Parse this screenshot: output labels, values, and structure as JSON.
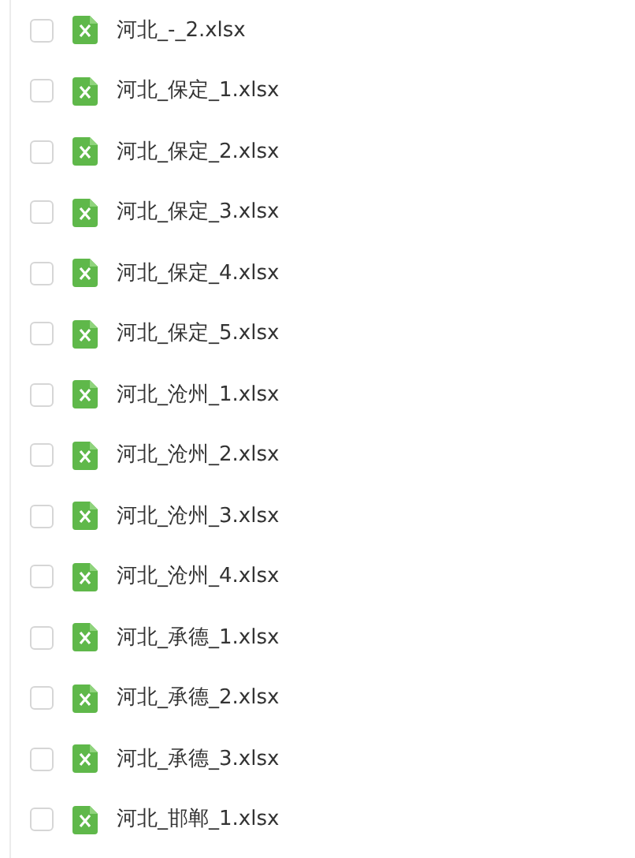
{
  "files": [
    {
      "name": "河北_-_2.xlsx",
      "checked": false
    },
    {
      "name": "河北_保定_1.xlsx",
      "checked": false
    },
    {
      "name": "河北_保定_2.xlsx",
      "checked": false
    },
    {
      "name": "河北_保定_3.xlsx",
      "checked": false
    },
    {
      "name": "河北_保定_4.xlsx",
      "checked": false
    },
    {
      "name": "河北_保定_5.xlsx",
      "checked": false
    },
    {
      "name": "河北_沧州_1.xlsx",
      "checked": false
    },
    {
      "name": "河北_沧州_2.xlsx",
      "checked": false
    },
    {
      "name": "河北_沧州_3.xlsx",
      "checked": false
    },
    {
      "name": "河北_沧州_4.xlsx",
      "checked": false
    },
    {
      "name": "河北_承德_1.xlsx",
      "checked": false
    },
    {
      "name": "河北_承德_2.xlsx",
      "checked": false
    },
    {
      "name": "河北_承德_3.xlsx",
      "checked": false
    },
    {
      "name": "河北_邯郸_1.xlsx",
      "checked": false
    }
  ]
}
